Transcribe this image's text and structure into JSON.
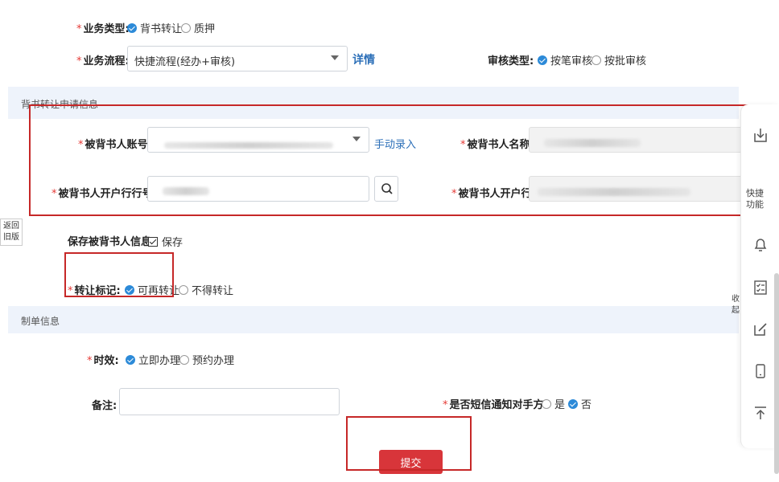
{
  "business_type": {
    "label": "业务类型:",
    "options": [
      {
        "label": "背书转让",
        "selected": true
      },
      {
        "label": "质押",
        "selected": false
      }
    ]
  },
  "business_flow": {
    "label": "业务流程:",
    "value": "快捷流程(经办+审核)",
    "detail_link": "详情"
  },
  "review_type": {
    "label": "审核类型:",
    "options": [
      {
        "label": "按笔审核",
        "selected": true
      },
      {
        "label": "按批审核",
        "selected": false
      }
    ]
  },
  "section_apply": {
    "title": "背书转让申请信息"
  },
  "endorsee_account": {
    "label": "被背书人账号:",
    "manual_link": "手动录入"
  },
  "endorsee_name": {
    "label": "被背书人名称:"
  },
  "endorsee_bank_no": {
    "label": "被背书人开户行行号:"
  },
  "endorsee_bank": {
    "label": "被背书人开户行:"
  },
  "save_info": {
    "label": "保存被背书人信息:",
    "option": "保存",
    "checked": true
  },
  "transfer_mark": {
    "label": "转让标记:",
    "options": [
      {
        "label": "可再转让",
        "selected": true
      },
      {
        "label": "不得转让",
        "selected": false
      }
    ]
  },
  "section_doc": {
    "title": "制单信息"
  },
  "timing": {
    "label": "时效:",
    "options": [
      {
        "label": "立即办理",
        "selected": true
      },
      {
        "label": "预约办理",
        "selected": false
      }
    ]
  },
  "remark": {
    "label": "备注:",
    "value": ""
  },
  "sms_notify": {
    "label": "是否短信通知对手方:",
    "options": [
      {
        "label": "是",
        "selected": false
      },
      {
        "label": "否",
        "selected": true
      }
    ]
  },
  "submit": {
    "label": "提交"
  },
  "back_old": {
    "label": "返回旧版"
  },
  "sidebar": {
    "quick_label": "快捷功能",
    "collapse_label": "收起"
  },
  "colors": {
    "accent": "#2c8ad8",
    "submit": "#d8353a",
    "highlight_box": "#c62828",
    "section_bg": "#eef3fb"
  }
}
